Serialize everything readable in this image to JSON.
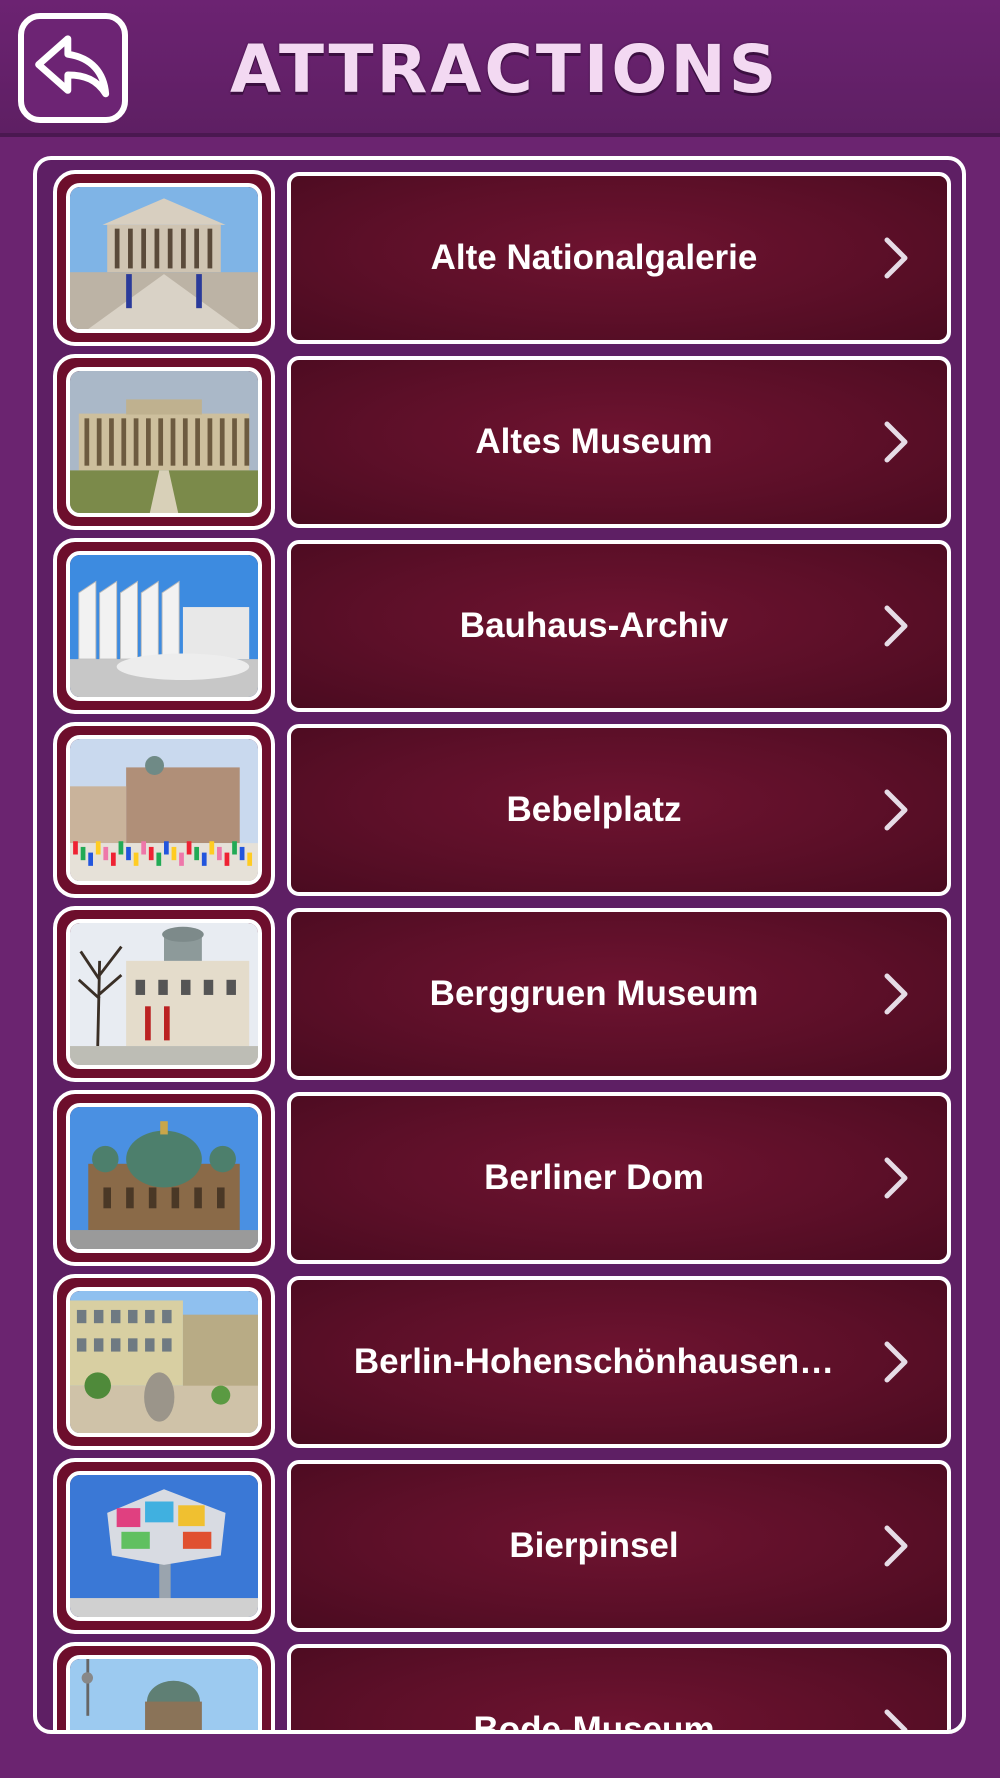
{
  "header": {
    "title": "ATTRACTIONS",
    "back_icon": "back-arrow-icon"
  },
  "colors": {
    "background": "#6b2470",
    "item_fill": "#5c0f28",
    "title_text": "#f3d9f2",
    "border": "#ffffff"
  },
  "attractions": [
    {
      "label": "Alte Nationalgalerie",
      "thumbnail": "neoclassical-museum-photo"
    },
    {
      "label": "Altes Museum",
      "thumbnail": "colonnade-museum-photo"
    },
    {
      "label": "Bauhaus-Archiv",
      "thumbnail": "modern-white-building-photo"
    },
    {
      "label": "Bebelplatz",
      "thumbnail": "square-with-crowd-photo"
    },
    {
      "label": "Berggruen Museum",
      "thumbnail": "domed-building-photo"
    },
    {
      "label": "Berliner Dom",
      "thumbnail": "cathedral-photo"
    },
    {
      "label": "Berlin-Hohenschönhausen…",
      "thumbnail": "memorial-courtyard-photo"
    },
    {
      "label": "Bierpinsel",
      "thumbnail": "colorful-tower-photo"
    },
    {
      "label": "Bode-Museum",
      "thumbnail": "dome-and-tv-tower-photo"
    }
  ]
}
